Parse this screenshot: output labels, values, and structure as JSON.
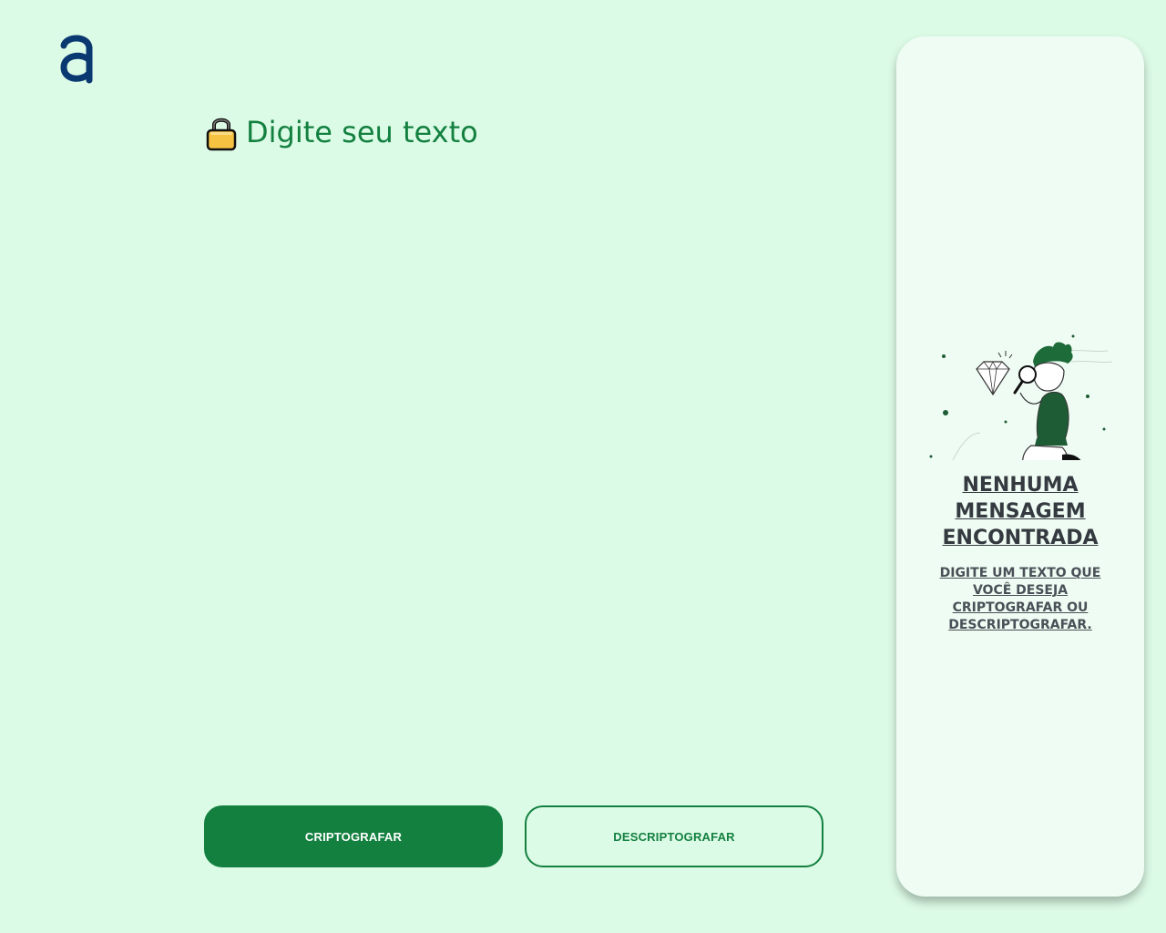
{
  "logo": {
    "icon": "alura-logo-icon",
    "color": "#0a3871"
  },
  "input": {
    "icon": "lock-icon",
    "placeholder": "Digite seu texto",
    "value": ""
  },
  "buttons": {
    "encrypt_label": "CRIPTOGRAFAR",
    "decrypt_label": "DESCRIPTOGRAFAR"
  },
  "output_panel": {
    "illustration": "person-with-magnifier-illustration",
    "title": "NENHUMA MENSAGEM ENCONTRADA",
    "subtitle": "DIGITE UM TEXTO QUE VOCÊ DESEJA CRIPTOGRAFAR OU DESCRIPTOGRAFAR."
  },
  "colors": {
    "background": "#dcfbe6",
    "accent": "#138040",
    "panel": "#effcf3",
    "title_text": "#343a40"
  }
}
